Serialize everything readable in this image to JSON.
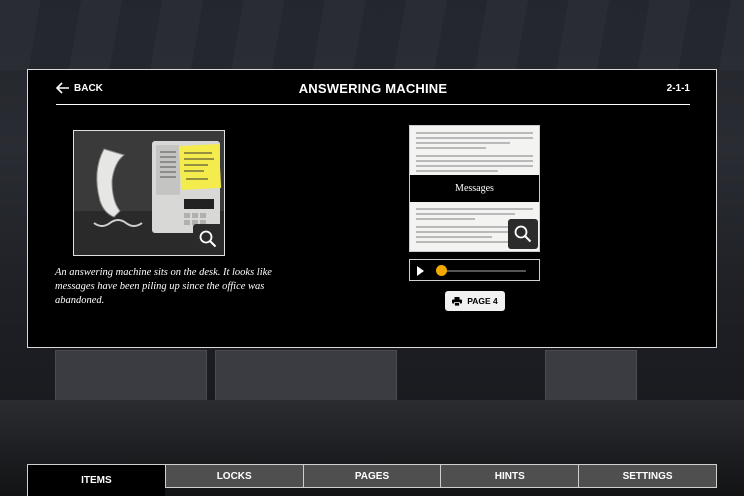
{
  "header": {
    "back_label": "BACK",
    "title": "ANSWERING MACHINE",
    "code": "2-1-1"
  },
  "item": {
    "description": "An answering machine sits on the desk. It looks like messages have been piling up since the office was abandoned.",
    "sticky_note_text": "I REFUSE to listen to all the Messages! It's TOO CREEPY",
    "doc_band_label": "Messages",
    "page_button_label": "PAGE 4"
  },
  "tabs": [
    {
      "label": "ITEMS",
      "active": true
    },
    {
      "label": "LOCKS"
    },
    {
      "label": "PAGES"
    },
    {
      "label": "HINTS"
    },
    {
      "label": "SETTINGS"
    }
  ],
  "colors": {
    "accent": "#f2a900",
    "panel_bg": "#000000",
    "tab_bg": "#4f4f4f"
  },
  "icons": [
    "back-arrow-icon",
    "magnifier-icon",
    "play-icon",
    "printer-icon"
  ],
  "audio": {
    "progress": 0.05
  }
}
